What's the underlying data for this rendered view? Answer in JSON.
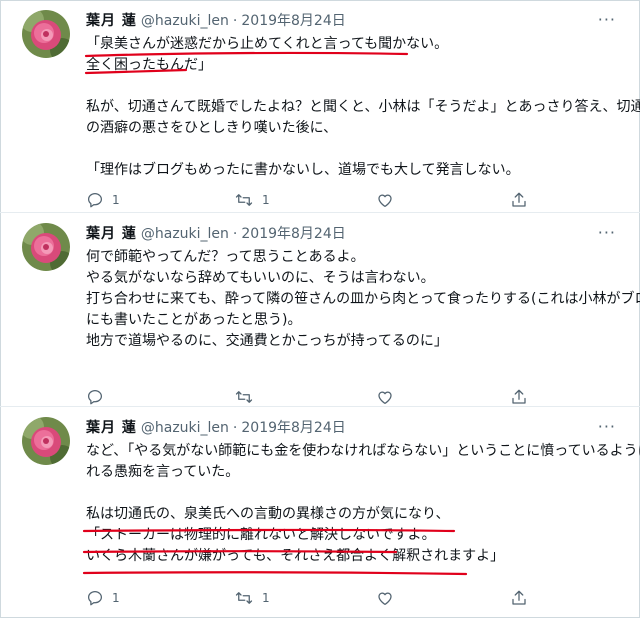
{
  "colors": {
    "accent_red": "#e0001b",
    "muted": "#536471",
    "text": "#0f1419",
    "border": "#cfd9de"
  },
  "icons": [
    "avatar-rose-image",
    "more-icon",
    "reply-icon",
    "retweet-icon",
    "like-icon",
    "share-icon"
  ],
  "tweets": [
    {
      "name": "葉月 蓮",
      "handle": "@hazuki_len",
      "date": "2019年8月24日",
      "more": "···",
      "lines": [
        "「泉美さんが迷惑だから止めてくれと言っても聞かない。",
        "全く困ったもんだ」",
        "",
        "私が、切通さんて既婚でしたよね？と聞くと、小林は「そうだよ」とあっさり答え、切通氏",
        "の酒癖の悪さをひとしきり嘆いた後に、",
        "",
        "「理作はブログもめったに書かないし、道場でも大して発言しない。"
      ],
      "reply_count": "1",
      "retweet_count": "1"
    },
    {
      "name": "葉月 蓮",
      "handle": "@hazuki_len",
      "date": "2019年8月24日",
      "more": "···",
      "lines": [
        "何で師範やってんだ？って思うことあるよ。",
        "やる気がないなら辞めてもいいのに、そうは言わない。",
        "打ち合わせに来ても、酔って隣の笹さんの皿から肉とって食ったりする(これは小林がブログ",
        "にも書いたことがあったと思う)。",
        "地方で道場やるのに、交通費とかこっちが持ってるのに」"
      ],
      "reply_count": "",
      "retweet_count": ""
    },
    {
      "name": "葉月 蓮",
      "handle": "@hazuki_len",
      "date": "2019年8月24日",
      "more": "···",
      "lines": [
        "など、「やる気がない師範にも金を使わなければならない」ということに憤っているようにと",
        "れる愚痴を言っていた。",
        "",
        "私は切通氏の、泉美氏への言動の異様さの方が気になり、",
        "「ストーカーは物理的に離れないと解決しないですよ。",
        "いくら木蘭さんが嫌がっても、それさえ都合よく解釈されますよ」"
      ],
      "reply_count": "1",
      "retweet_count": "1"
    }
  ]
}
